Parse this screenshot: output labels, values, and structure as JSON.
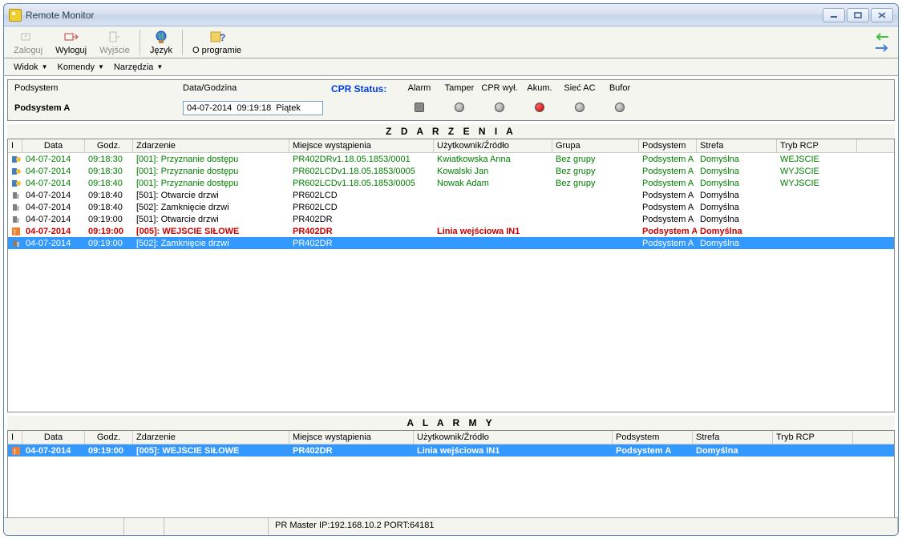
{
  "window": {
    "title": "Remote Monitor"
  },
  "toolbar": {
    "login": "Zaloguj",
    "logout": "Wyloguj",
    "exit": "Wyjście",
    "language": "Język",
    "about": "O programie"
  },
  "menu": {
    "view": "Widok",
    "commands": "Komendy",
    "tools": "Narzędzia"
  },
  "status": {
    "subsystem_label": "Podsystem",
    "datetime_label": "Data/Godzina",
    "cpr_status": "CPR Status:",
    "subsystem_value": "Podsystem A",
    "datetime_value": "04-07-2014  09:19:18  Piątek",
    "leds": {
      "alarm": "Alarm",
      "tamper": "Tamper",
      "cpr_off": "CPR wył.",
      "akum": "Akum.",
      "siec_ac": "Sieć AC",
      "bufor": "Bufor"
    }
  },
  "sections": {
    "events": "Z D A R Z E N I A",
    "alarms": "A L A R M Y"
  },
  "events_columns": {
    "i": "I",
    "date": "Data",
    "time": "Godz.",
    "event": "Zdarzenie",
    "location": "Miejsce wystąpienia",
    "user": "Użytkownik/Źródło",
    "group": "Grupa",
    "subsystem": "Podsystem",
    "zone": "Strefa",
    "rcp": "Tryb RCP"
  },
  "alarms_columns": {
    "i": "I",
    "date": "Data",
    "time": "Godz.",
    "event": "Zdarzenie",
    "location": "Miejsce wystąpienia",
    "user": "Użytkownik/Źródło",
    "subsystem": "Podsystem",
    "zone": "Strefa",
    "rcp": "Tryb RCP"
  },
  "events": [
    {
      "style": "green",
      "date": "04-07-2014",
      "time": "09:18:30",
      "event": "[001]: Przyznanie dostępu",
      "location": "PR402DRv1.18.05.1853/0001",
      "user": "Kwiatkowska Anna",
      "group": "Bez grupy",
      "subsystem": "Podsystem A",
      "zone": "Domyślna",
      "rcp": "WEJŚCIE"
    },
    {
      "style": "green",
      "date": "04-07-2014",
      "time": "09:18:30",
      "event": "[001]: Przyznanie dostępu",
      "location": "PR602LCDv1.18.05.1853/0005",
      "user": "Kowalski Jan",
      "group": "Bez grupy",
      "subsystem": "Podsystem A",
      "zone": "Domyślna",
      "rcp": "WYJŚCIE"
    },
    {
      "style": "green",
      "date": "04-07-2014",
      "time": "09:18:40",
      "event": "[001]: Przyznanie dostępu",
      "location": "PR602LCDv1.18.05.1853/0005",
      "user": "Nowak Adam",
      "group": "Bez grupy",
      "subsystem": "Podsystem A",
      "zone": "Domyślna",
      "rcp": "WYJŚCIE"
    },
    {
      "style": "black",
      "date": "04-07-2014",
      "time": "09:18:40",
      "event": "[501]: Otwarcie drzwi",
      "location": "PR602LCD",
      "user": "",
      "group": "",
      "subsystem": "Podsystem A",
      "zone": "Domyślna",
      "rcp": ""
    },
    {
      "style": "black",
      "date": "04-07-2014",
      "time": "09:18:40",
      "event": "[502]: Zamknięcie drzwi",
      "location": "PR602LCD",
      "user": "",
      "group": "",
      "subsystem": "Podsystem A",
      "zone": "Domyślna",
      "rcp": ""
    },
    {
      "style": "black",
      "date": "04-07-2014",
      "time": "09:19:00",
      "event": "[501]: Otwarcie drzwi",
      "location": "PR402DR",
      "user": "",
      "group": "",
      "subsystem": "Podsystem A",
      "zone": "Domyślna",
      "rcp": ""
    },
    {
      "style": "red",
      "date": "04-07-2014",
      "time": "09:19:00",
      "event": "[005]: WEJŚCIE SIŁOWE",
      "location": "PR402DR",
      "user": "Linia wejściowa IN1",
      "group": "",
      "subsystem": "Podsystem A",
      "zone": "Domyślna",
      "rcp": ""
    },
    {
      "style": "selected",
      "date": "04-07-2014",
      "time": "09:19:00",
      "event": "[502]: Zamknięcie drzwi",
      "location": "PR402DR",
      "user": "",
      "group": "",
      "subsystem": "Podsystem A",
      "zone": "Domyślna",
      "rcp": ""
    }
  ],
  "alarms": [
    {
      "style": "alarm-selected",
      "date": "04-07-2014",
      "time": "09:19:00",
      "event": "[005]: WEJŚCIE SIŁOWE",
      "location": "PR402DR",
      "user": "Linia wejściowa IN1",
      "subsystem": "Podsystem A",
      "zone": "Domyślna",
      "rcp": ""
    }
  ],
  "statusbar": {
    "master": "PR Master  IP:192.168.10.2  PORT:64181"
  }
}
